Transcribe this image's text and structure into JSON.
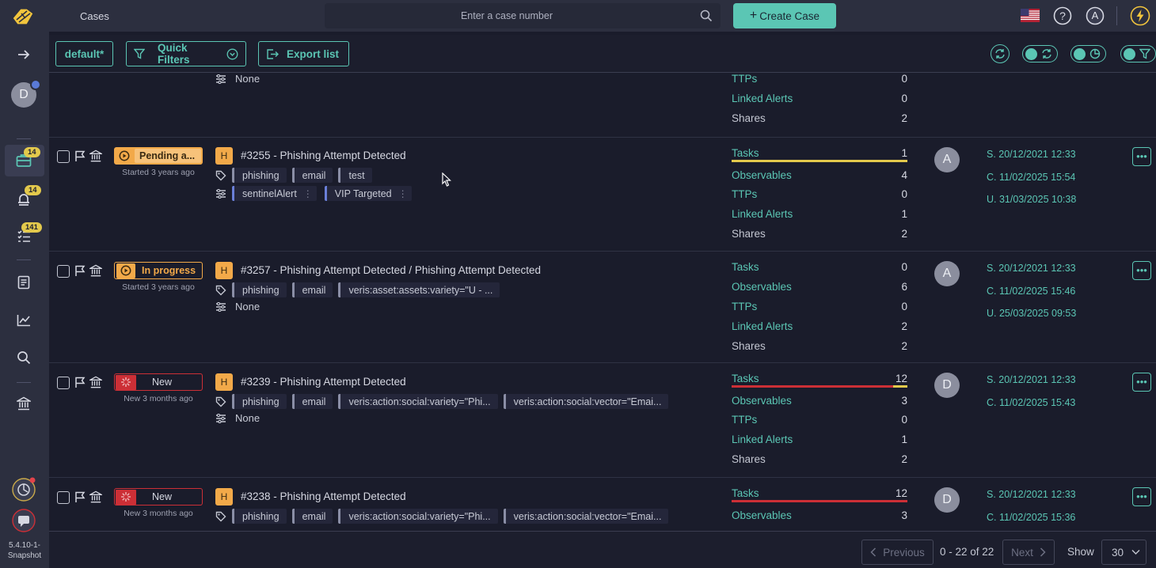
{
  "header": {
    "app_title": "Cases",
    "search_placeholder": "Enter a case number",
    "create_label": "Create Case",
    "user_initial": "A"
  },
  "sidebar": {
    "user_initial": "D",
    "cases_badge": "14",
    "alerts_badge": "14",
    "tasks_badge": "141",
    "version": "5.4.10-1-Snapshot"
  },
  "toolbar": {
    "filter_name": "default*",
    "quick_filters": "Quick Filters",
    "export_list": "Export list"
  },
  "colors": {
    "accent": "#5bc6b4",
    "amber": "#f2a949",
    "red": "#cc2f36",
    "yellow": "#e3c94c",
    "link_tag": "#6a7fd8"
  },
  "top_partial": {
    "custom_fields_text": "None",
    "stats": [
      {
        "label": "TTPs",
        "value": "0"
      },
      {
        "label": "Linked Alerts",
        "value": "0"
      },
      {
        "label": "Shares",
        "value": "2"
      }
    ]
  },
  "cases": [
    {
      "status": "Pending a...",
      "status_type": "pending",
      "started": "Started 3 years ago",
      "severity": "H",
      "title": "#3255 - Phishing Attempt Detected",
      "tags": [
        "phishing",
        "email",
        "test"
      ],
      "custom_fields": [
        "sentinelAlert",
        "VIP Targeted"
      ],
      "stats": [
        {
          "label": "Tasks",
          "value": "1"
        },
        {
          "label": "Observables",
          "value": "4"
        },
        {
          "label": "TTPs",
          "value": "0"
        },
        {
          "label": "Linked Alerts",
          "value": "1"
        },
        {
          "label": "Shares",
          "value": "2"
        }
      ],
      "task_progress": 1.0,
      "assignee": "A",
      "dates": [
        "S. 20/12/2021 12:33",
        "C. 11/02/2025 15:54",
        "U. 31/03/2025 10:38"
      ]
    },
    {
      "status": "In progress",
      "status_type": "inprog",
      "started": "Started 3 years ago",
      "severity": "H",
      "title": "#3257 - Phishing Attempt Detected / Phishing Attempt Detected",
      "tags": [
        "phishing",
        "email",
        "veris:asset:assets:variety=\"U - ..."
      ],
      "custom_fields_text": "None",
      "stats": [
        {
          "label": "Tasks",
          "value": "0"
        },
        {
          "label": "Observables",
          "value": "6"
        },
        {
          "label": "TTPs",
          "value": "0"
        },
        {
          "label": "Linked Alerts",
          "value": "2"
        },
        {
          "label": "Shares",
          "value": "2"
        }
      ],
      "assignee": "A",
      "dates": [
        "S. 20/12/2021 12:33",
        "C. 11/02/2025 15:46",
        "U. 25/03/2025 09:53"
      ]
    },
    {
      "status": "New",
      "status_type": "new",
      "started": "New 3 months ago",
      "severity": "H",
      "title": "#3239 - Phishing Attempt Detected",
      "tags": [
        "phishing",
        "email",
        "veris:action:social:variety=\"Phi...",
        "veris:action:social:vector=\"Emai..."
      ],
      "custom_fields_text": "None",
      "stats": [
        {
          "label": "Tasks",
          "value": "12"
        },
        {
          "label": "Observables",
          "value": "3"
        },
        {
          "label": "TTPs",
          "value": "0"
        },
        {
          "label": "Linked Alerts",
          "value": "1"
        },
        {
          "label": "Shares",
          "value": "2"
        }
      ],
      "task_progress": 0.92,
      "assignee": "D",
      "dates": [
        "S. 20/12/2021 12:33",
        "C. 11/02/2025 15:43"
      ]
    },
    {
      "status": "New",
      "status_type": "new",
      "started": "New 3 months ago",
      "severity": "H",
      "title": "#3238 - Phishing Attempt Detected",
      "tags": [
        "phishing",
        "email",
        "veris:action:social:variety=\"Phi...",
        "veris:action:social:vector=\"Emai..."
      ],
      "stats": [
        {
          "label": "Tasks",
          "value": "12"
        },
        {
          "label": "Observables",
          "value": "3"
        }
      ],
      "task_progress": 0.0,
      "assignee": "D",
      "dates": [
        "S. 20/12/2021 12:33",
        "C. 11/02/2025 15:36"
      ]
    }
  ],
  "pagination": {
    "previous": "Previous",
    "range": "0 - 22 of 22",
    "next": "Next",
    "show_label": "Show",
    "page_size": "30"
  }
}
